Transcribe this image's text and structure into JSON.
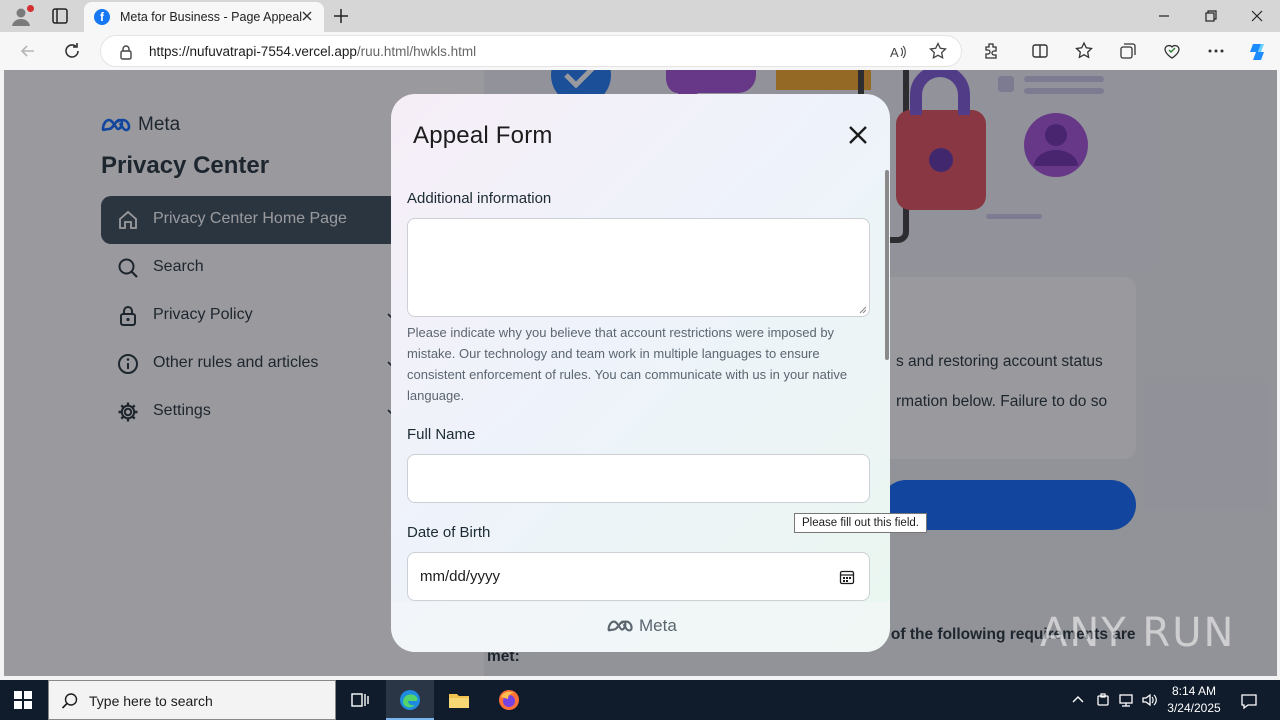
{
  "browser": {
    "tab_title": "Meta for Business - Page Appeal",
    "url_host": "https://nufuvatrapi-7554.vercel.app",
    "url_path": "/ruu.html/hwkls.html"
  },
  "sidebar": {
    "brand": "Meta",
    "title": "Privacy Center",
    "items": [
      {
        "label": "Privacy Center Home Page",
        "icon": "home-icon"
      },
      {
        "label": "Search",
        "icon": "search-icon"
      },
      {
        "label": "Privacy Policy",
        "icon": "lock-icon"
      },
      {
        "label": "Other rules and articles",
        "icon": "info-icon"
      },
      {
        "label": "Settings",
        "icon": "gear-icon"
      }
    ]
  },
  "background_content": {
    "card_line1": "s and restoring account status",
    "card_line2": "rmation below. Failure to do so",
    "requirements_line1": "e of the following requirements are",
    "requirements_line2": "met:"
  },
  "modal": {
    "title": "Appeal Form",
    "additional_label": "Additional information",
    "help_text": "Please indicate why you believe that account restrictions were imposed by mistake. Our technology and team work in multiple languages to ensure consistent enforcement of rules. You can communicate with us in your native language.",
    "full_name_label": "Full Name",
    "dob_label": "Date of Birth",
    "dob_placeholder": "mm/dd/yyyy",
    "footer_brand": "Meta"
  },
  "tooltip": "Please fill out this field.",
  "watermark": "ANY RUN",
  "taskbar": {
    "search_placeholder": "Type here to search",
    "time": "8:14 AM",
    "date": "3/24/2025"
  },
  "colors": {
    "meta_blue": "#0866ff",
    "facebook_blue": "#1877f2",
    "nav_active": "#344854",
    "taskbar": "#101b2b"
  }
}
